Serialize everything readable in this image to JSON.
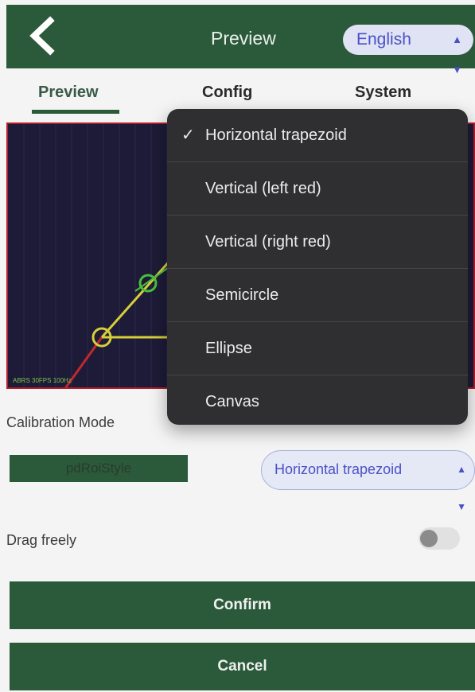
{
  "header": {
    "title": "Preview",
    "language": "English",
    "back_icon": "chevron-left-icon"
  },
  "tabs": [
    {
      "label": "Preview",
      "active": true
    },
    {
      "label": "Config",
      "active": false
    },
    {
      "label": "System",
      "active": false
    }
  ],
  "preview": {
    "caption": "ABRS 30FPS 100Hz",
    "border_color": "#b0202c"
  },
  "calibration": {
    "label": "Calibration Mode",
    "style_chip": "pdRoiStyle",
    "selected_shape": "Horizontal trapezoid"
  },
  "drag": {
    "label": "Drag freely",
    "enabled": false
  },
  "buttons": {
    "confirm": "Confirm",
    "cancel": "Cancel"
  },
  "menu": {
    "items": [
      "Horizontal trapezoid",
      "Vertical (left red)",
      "Vertical (right red)",
      "Semicircle",
      "Ellipse",
      "Canvas"
    ],
    "selected_index": 0,
    "check_glyph": "✓"
  },
  "colors": {
    "brand_green": "#2b5a3a",
    "accent_blue": "#4a50c8"
  }
}
